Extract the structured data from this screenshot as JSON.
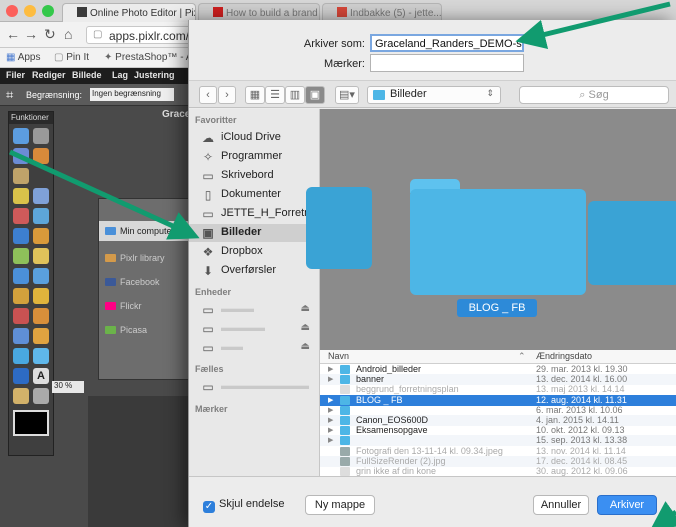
{
  "browser": {
    "tabs": [
      {
        "label": "Online Photo Editor | Pixlr",
        "favicon_color": "#3b3b3b"
      },
      {
        "label": "How to build a brand vis...",
        "favicon_color": "#cc1f1f"
      },
      {
        "label": "Indbakke (5) - jette...",
        "favicon_color": "#d44638"
      }
    ],
    "url": "apps.pixlr.com/edit",
    "bookmarks": [
      "Apps",
      "Pin It",
      "PrestaShop™ - Ad"
    ]
  },
  "pixlr": {
    "menu": [
      "Filer",
      "Rediger",
      "Billede",
      "Lag",
      "Justering"
    ],
    "options_label": "Begrænsning:",
    "options_value": "Ingen begrænsning",
    "tools_title": "Funktioner",
    "canvas_title": "Grace",
    "open_dialog_items": [
      "Min computer",
      "Pixlr library",
      "Facebook",
      "Flickr",
      "Picasa"
    ],
    "zoom_value": "30 %"
  },
  "dialog": {
    "save_as_label": "Arkiver som:",
    "filename": "Graceland_Randers_DEMO-skåret",
    "tags_label": "Mærker:",
    "tags_value": "",
    "location": "Billeder",
    "search_placeholder": "Søg",
    "sidebar": {
      "favorites_heading": "Favoritter",
      "favorites": [
        {
          "label": "iCloud Drive",
          "icon": "cloud-icon"
        },
        {
          "label": "Programmer",
          "icon": "apps-icon"
        },
        {
          "label": "Skrivebord",
          "icon": "desktop-icon"
        },
        {
          "label": "Dokumenter",
          "icon": "document-icon"
        },
        {
          "label": "JETTE_H_Forretning",
          "icon": "folder-icon"
        },
        {
          "label": "Billeder",
          "icon": "camera-icon"
        },
        {
          "label": "Dropbox",
          "icon": "dropbox-icon"
        },
        {
          "label": "Overførsler",
          "icon": "download-icon"
        }
      ],
      "devices_heading": "Enheder",
      "shared_heading": "Fælles",
      "tags_heading": "Mærker"
    },
    "preview_label": "BLOG _ FB",
    "columns": {
      "name": "Navn",
      "date": "Ændringsdato"
    },
    "files": [
      {
        "name": "Android_billeder",
        "date": "29. mar. 2013 kl. 19.30",
        "kind": "folder",
        "state": "normal"
      },
      {
        "name": "banner",
        "date": "13. dec. 2014 kl. 16.00",
        "kind": "folder",
        "state": "normal"
      },
      {
        "name": "beggrund_forretningsplan",
        "date": "13. maj 2013 kl. 14.14",
        "kind": "file",
        "state": "faded"
      },
      {
        "name": "BLOG _ FB",
        "date": "12. aug. 2014 kl. 11.31",
        "kind": "folder",
        "state": "selected"
      },
      {
        "name": "",
        "date": "6. mar. 2013 kl. 10.06",
        "kind": "folder",
        "state": "normal"
      },
      {
        "name": "Canon_EOS600D",
        "date": "4. jan. 2015 kl. 14.11",
        "kind": "folder",
        "state": "normal"
      },
      {
        "name": "Eksamensopgave",
        "date": "10. okt. 2012 kl. 09.13",
        "kind": "folder",
        "state": "normal"
      },
      {
        "name": "",
        "date": "15. sep. 2013 kl. 13.38",
        "kind": "folder",
        "state": "normal"
      },
      {
        "name": "Fotografi den 13-11-14 kl. 09.34.jpeg",
        "date": "13. nov. 2014 kl. 11.14",
        "kind": "image",
        "state": "faded"
      },
      {
        "name": "FullSizeRender (2).jpg",
        "date": "17. dec. 2014 kl. 08.45",
        "kind": "image",
        "state": "faded"
      },
      {
        "name": "grin ikke af din kone",
        "date": "30. aug. 2012 kl. 09.06",
        "kind": "file",
        "state": "faded"
      }
    ],
    "hide_extension_label": "Skjul endelse",
    "new_folder_label": "Ny mappe",
    "cancel_label": "Annuller",
    "save_label": "Arkiver"
  },
  "colors": {
    "annotation_arrow": "#119b6f",
    "accent_blue": "#2d7fdb",
    "folder_blue": "#4db6e6"
  }
}
